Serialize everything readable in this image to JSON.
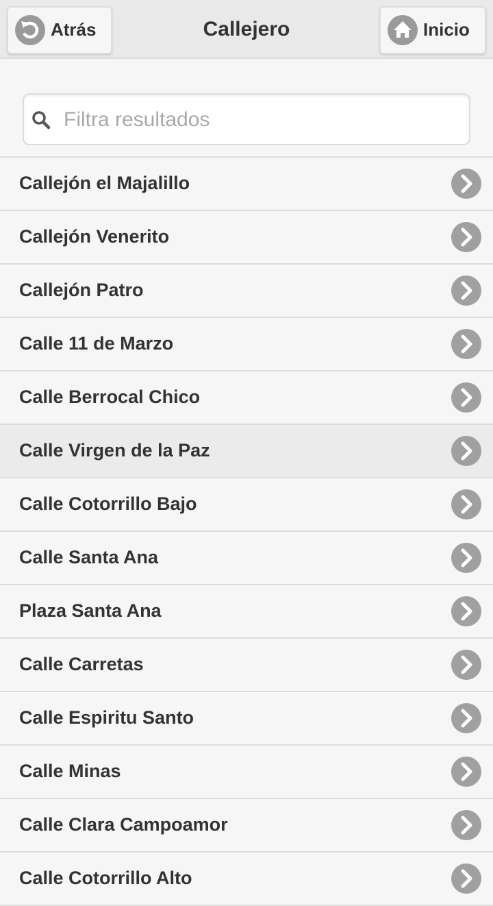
{
  "header": {
    "title": "Callejero",
    "back_label": "Atrás",
    "home_label": "Inicio"
  },
  "search": {
    "placeholder": "Filtra resultados",
    "value": ""
  },
  "colors": {
    "header_bg": "#e9e9e9",
    "list_bg": "#f6f6f6",
    "icon_circle": "#a0a0a0",
    "text": "#333333"
  },
  "streets": [
    {
      "name": "Callejón el Majalillo",
      "icon": "chevron-right-icon"
    },
    {
      "name": "Callejón Venerito",
      "icon": "chevron-right-icon"
    },
    {
      "name": "Callejón Patro",
      "icon": "chevron-right-icon"
    },
    {
      "name": "Calle 11 de Marzo",
      "icon": "chevron-right-icon"
    },
    {
      "name": "Calle Berrocal Chico",
      "icon": "chevron-right-icon"
    },
    {
      "name": "Calle Virgen de la Paz",
      "icon": "chevron-right-icon"
    },
    {
      "name": "Calle Cotorrillo Bajo",
      "icon": "chevron-right-icon"
    },
    {
      "name": "Calle Santa Ana",
      "icon": "chevron-right-icon"
    },
    {
      "name": "Plaza Santa Ana",
      "icon": "chevron-right-icon"
    },
    {
      "name": "Calle Carretas",
      "icon": "chevron-right-icon"
    },
    {
      "name": "Calle Espiritu Santo",
      "icon": "chevron-right-icon"
    },
    {
      "name": "Calle Minas",
      "icon": "chevron-right-icon"
    },
    {
      "name": "Calle Clara Campoamor",
      "icon": "chevron-right-icon"
    },
    {
      "name": "Calle Cotorrillo Alto",
      "icon": "chevron-right-icon"
    }
  ]
}
